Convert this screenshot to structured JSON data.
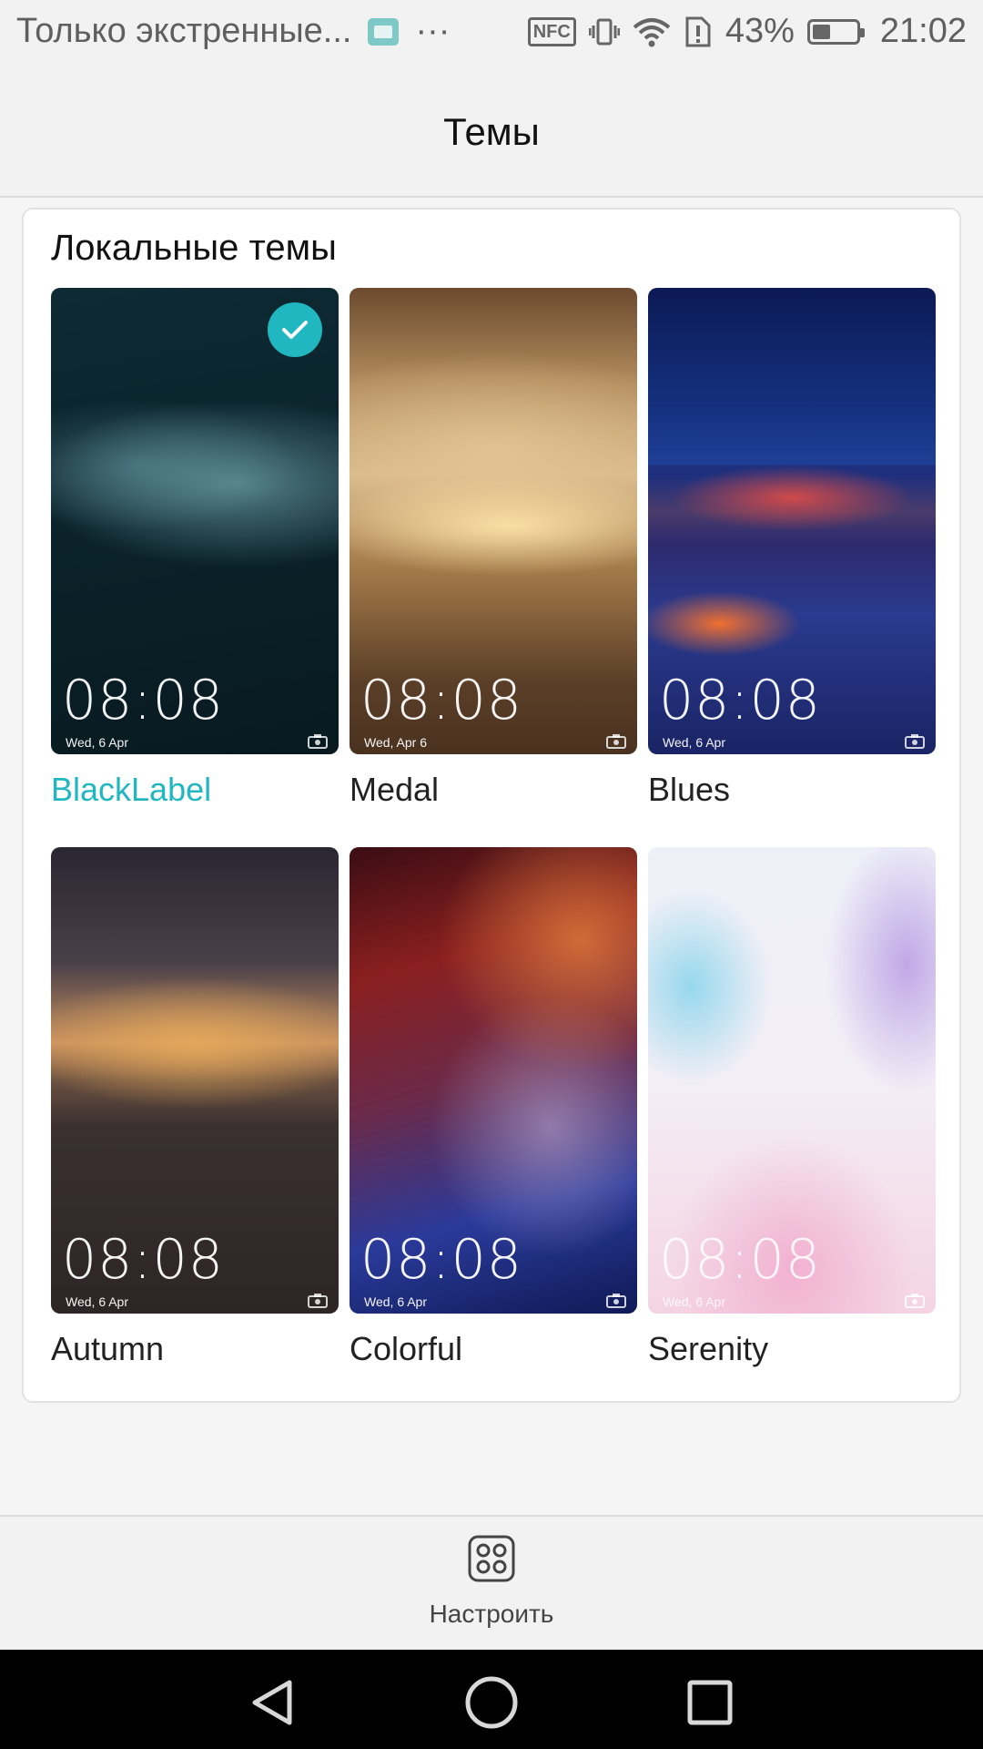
{
  "status_bar": {
    "notification_text": "Только экстренные...",
    "overflow": "···",
    "nfc": "NFC",
    "battery_percent": "43%",
    "time": "21:02"
  },
  "header": {
    "title": "Темы"
  },
  "section": {
    "title": "Локальные темы"
  },
  "themes": [
    {
      "name": "BlackLabel",
      "clock": "08:08",
      "date": "Wed, 6 Apr",
      "selected": true
    },
    {
      "name": "Medal",
      "clock": "08:08",
      "date": "Wed, Apr 6",
      "selected": false
    },
    {
      "name": "Blues",
      "clock": "08:08",
      "date": "Wed, 6 Apr",
      "selected": false
    },
    {
      "name": "Autumn",
      "clock": "08:08",
      "date": "Wed, 6 Apr",
      "selected": false
    },
    {
      "name": "Colorful",
      "clock": "08:08",
      "date": "Wed, 6 Apr",
      "selected": false
    },
    {
      "name": "Serenity",
      "clock": "08:08",
      "date": "Wed, 6 Apr",
      "selected": false
    }
  ],
  "toolbar": {
    "customize_label": "Настроить"
  },
  "colors": {
    "accent": "#21b7c0"
  }
}
